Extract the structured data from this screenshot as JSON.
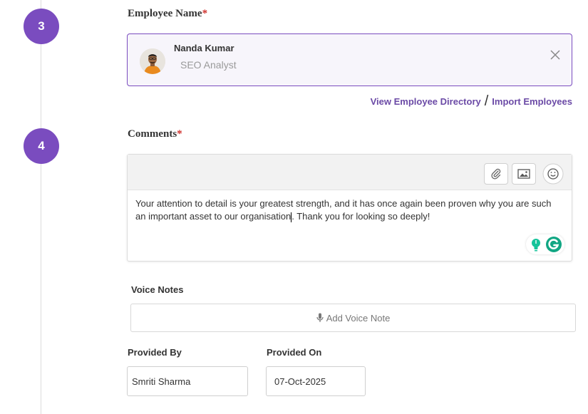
{
  "steps": [
    {
      "number": "3"
    },
    {
      "number": "4"
    }
  ],
  "employee_field": {
    "label": "Employee Name",
    "required_mark": "*",
    "selected": {
      "name": "Nanda Kumar",
      "role": "SEO Analyst"
    },
    "close_icon": "close-icon"
  },
  "links": {
    "directory": "View Employee Directory",
    "separator": "/",
    "import": "Import Employees"
  },
  "comments_field": {
    "label": "Comments",
    "required_mark": "*",
    "toolbar": [
      "attach-icon",
      "image-icon",
      "emoji-icon"
    ],
    "text_before_caret": "Your attention to detail is your greatest strength, and it has once again been proven why you are such an important asset to our organisation",
    "text_after_caret": ". Thank you for looking so deeply!"
  },
  "voice_notes": {
    "label": "Voice Notes",
    "button_label": "Add Voice Note",
    "icon": "microphone-icon"
  },
  "provided_by": {
    "label": "Provided By",
    "value": "Smriti Sharma"
  },
  "provided_on": {
    "label": "Provided On",
    "value": "07-Oct-2025"
  },
  "colors": {
    "accent": "#7a4cbf",
    "link": "#6b4aa6",
    "required": "#d0312d"
  }
}
